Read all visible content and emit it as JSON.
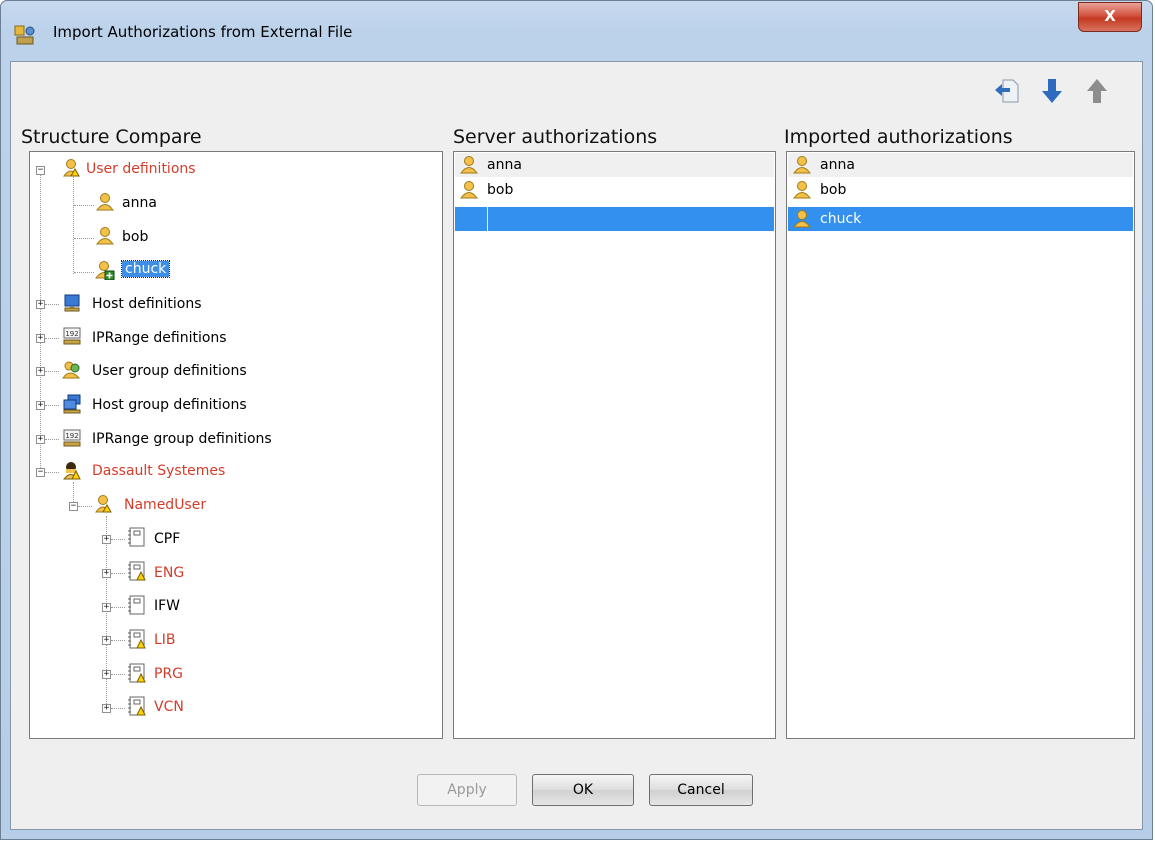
{
  "window": {
    "title": "Import Authorizations from External File",
    "close_label": "X"
  },
  "toolbar": {
    "buttons": [
      "import-icon",
      "arrow-down-icon",
      "arrow-up-icon"
    ]
  },
  "columns": {
    "structure_label": "Structure Compare",
    "server_label": "Server authorizations",
    "imported_label": "Imported authorizations"
  },
  "tree": {
    "user_definitions": "User definitions",
    "users": [
      "anna",
      "bob",
      "chuck"
    ],
    "host_definitions": "Host definitions",
    "iprange_definitions": "IPRange definitions",
    "user_group_definitions": "User group definitions",
    "host_group_definitions": "Host group definitions",
    "iprange_group_definitions": "IPRange group definitions",
    "dassault": "Dassault Systemes",
    "named_user": "NamedUser",
    "products": [
      "CPF",
      "ENG",
      "IFW",
      "LIB",
      "PRG",
      "VCN"
    ]
  },
  "server_list": [
    "anna",
    "bob",
    ""
  ],
  "imported_list": [
    "anna",
    "bob",
    "chuck"
  ],
  "buttons": {
    "apply": "Apply",
    "ok": "OK",
    "cancel": "Cancel"
  },
  "colors": {
    "modified_text": "#d43c2a",
    "selection": "#3390ee"
  }
}
